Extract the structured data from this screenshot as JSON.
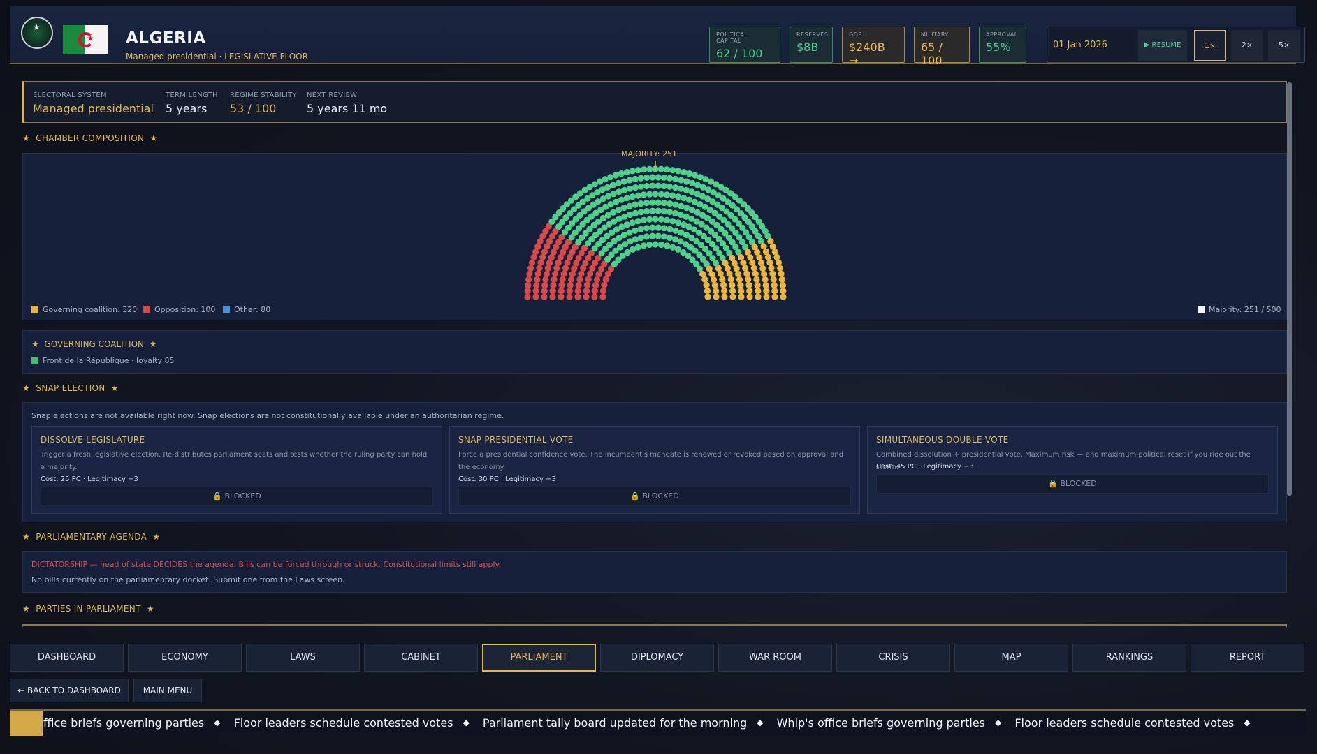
{
  "header": {
    "country": "ALGERIA",
    "subtitle": "Managed presidential · LEGISLATIVE FLOOR",
    "stats": [
      {
        "label": "POLITICAL CAPITAL",
        "value": "62 / 100"
      },
      {
        "label": "RESERVES",
        "value": "$8B"
      },
      {
        "label": "GDP",
        "value": "$240B →"
      },
      {
        "label": "MILITARY",
        "value": "65 / 100"
      },
      {
        "label": "APPROVAL",
        "value": "55%"
      }
    ],
    "date": "01 Jan 2026",
    "resume_label": "▶ RESUME",
    "speeds": [
      "1×",
      "2×",
      "5×"
    ]
  },
  "info": {
    "electoral_system_label": "ELECTORAL SYSTEM",
    "electoral_system": "Managed presidential",
    "term_length_label": "TERM LENGTH",
    "term_length": "5 years",
    "regime_stability_label": "REGIME STABILITY",
    "regime_stability": "53 / 100",
    "next_review_label": "NEXT REVIEW",
    "next_review": "5 years 11 mo"
  },
  "chamber": {
    "title": "CHAMBER COMPOSITION",
    "majority_label": "MAJORITY: 251",
    "legend": {
      "coalition": "Governing coalition: 320",
      "opposition": "Opposition: 100",
      "other": "Other: 80",
      "majority": "Majority: 251 / 500"
    },
    "colors": {
      "opposition": "#d84a4a",
      "coalition": "#4fcf8c",
      "coalition_alt": "#e8b53e",
      "other": "#4a8fd8"
    }
  },
  "chart_data": {
    "type": "parliament",
    "total_seats": 500,
    "majority": 251,
    "segments": [
      {
        "name": "Opposition",
        "seats": 100,
        "color": "#d84a4a"
      },
      {
        "name": "Governing coalition",
        "seats": 320,
        "color": "#4fcf8c"
      },
      {
        "name": "Other",
        "seats": 80,
        "color": "#e8b53e"
      }
    ]
  },
  "coalition": {
    "title": "GOVERNING COALITION",
    "item": "Front de la République · loyalty 85"
  },
  "snap": {
    "title": "SNAP ELECTION",
    "note": "Snap elections are not available right now. Snap elections are not constitutionally available under an authoritarian regime.",
    "cards": [
      {
        "title": "DISSOLVE LEGISLATURE",
        "desc": "Trigger a fresh legislative election. Re-distributes parliament seats and tests whether the ruling party can hold a majority.",
        "cost": "Cost: 25 PC · Legitimacy −3",
        "status": "🔒 BLOCKED"
      },
      {
        "title": "SNAP PRESIDENTIAL VOTE",
        "desc": "Force a presidential confidence vote. The incumbent's mandate is renewed or revoked based on approval and the economy.",
        "cost": "Cost: 30 PC · Legitimacy −3",
        "status": "🔒 BLOCKED"
      },
      {
        "title": "SIMULTANEOUS DOUBLE VOTE",
        "desc": "Combined dissolution + presidential vote. Maximum risk — and maximum political reset if you ride out the storm.",
        "cost": "Cost: 45 PC · Legitimacy −3",
        "status": "🔒 BLOCKED"
      }
    ]
  },
  "agenda": {
    "title": "PARLIAMENTARY AGENDA",
    "dictatorship": "DICTATORSHIP — head of state DECIDES the agenda. Bills can be forced through or struck. Constitutional limits still apply.",
    "no_bills": "No bills currently on the parliamentary docket. Submit one from the Laws screen."
  },
  "parties": {
    "title": "PARTIES IN PARLIAMENT"
  },
  "tabs": [
    "DASHBOARD",
    "ECONOMY",
    "LAWS",
    "CABINET",
    "PARLIAMENT",
    "DIPLOMACY",
    "WAR ROOM",
    "CRISIS",
    "MAP",
    "RANKINGS",
    "REPORT"
  ],
  "active_tab": "PARLIAMENT",
  "buttons": {
    "back": "← BACK TO DASHBOARD",
    "menu": "MAIN MENU"
  },
  "ticker": [
    "ffice briefs governing parties",
    "Floor leaders schedule contested votes",
    "Parliament tally board updated for the morning",
    "Whip's office briefs governing parties",
    "Floor leaders schedule contested votes"
  ]
}
